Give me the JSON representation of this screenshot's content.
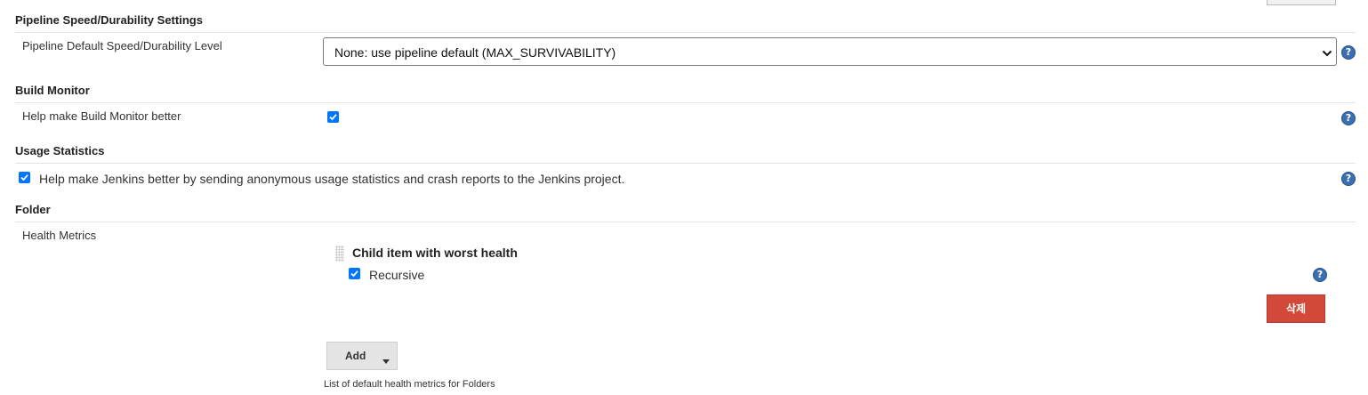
{
  "pipeline_section": {
    "title": "Pipeline Speed/Durability Settings",
    "level_label": "Pipeline Default Speed/Durability Level",
    "level_value": "None: use pipeline default (MAX_SURVIVABILITY)"
  },
  "build_monitor": {
    "title": "Build Monitor",
    "help_label": "Help make Build Monitor better",
    "checked": true
  },
  "usage_statistics": {
    "title": "Usage Statistics",
    "checkbox_label": "Help make Jenkins better by sending anonymous usage statistics and crash reports to the Jenkins project.",
    "checked": true
  },
  "folder": {
    "title": "Folder",
    "health_metrics_label": "Health Metrics",
    "metric": {
      "title": "Child item with worst health",
      "recursive_label": "Recursive",
      "recursive_checked": true,
      "delete_label": "삭제"
    },
    "add_label": "Add",
    "add_description": "List of default health metrics for Folders"
  },
  "icons": {
    "help": "help-icon",
    "checkbox": "checkmark-icon",
    "dropdown": "chevron-down-icon",
    "drag": "drag-handle-icon"
  },
  "colors": {
    "help_blue": "#3b6fb0",
    "checkbox_blue": "#0075ff",
    "delete_red": "#d24939"
  }
}
